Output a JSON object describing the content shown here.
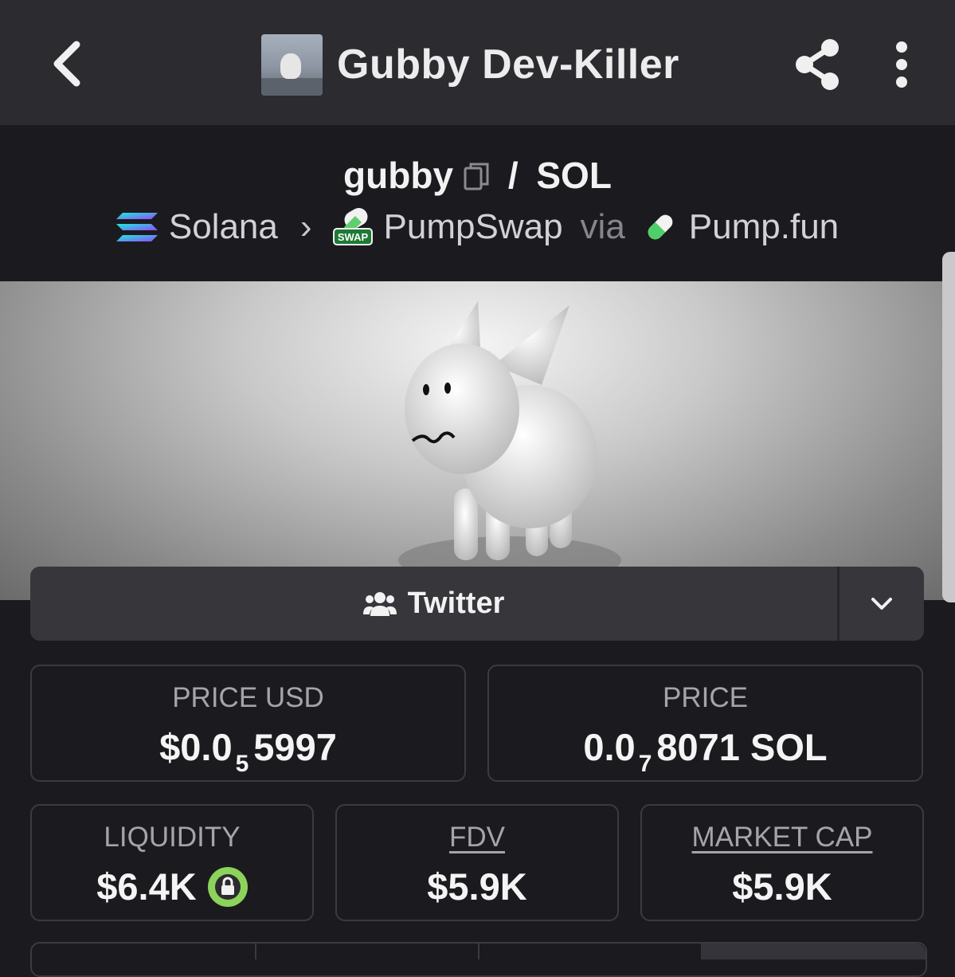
{
  "header": {
    "title": "Gubby Dev-Killer",
    "back_icon": "chevron-left-icon",
    "share_icon": "share-icon",
    "more_icon": "more-vertical-icon"
  },
  "pair": {
    "base": "gubby",
    "separator": "/",
    "quote": "SOL",
    "chain": "Solana",
    "dex": "PumpSwap",
    "via_label": "via",
    "launchpad": "Pump.fun",
    "dex_badge_text": "SWAP"
  },
  "twitter_bar": {
    "label": "Twitter",
    "icon": "users-icon",
    "dropdown_icon": "chevron-down-icon"
  },
  "stats": {
    "price_usd": {
      "label": "PRICE USD",
      "prefix": "$0.0",
      "zeros": "5",
      "digits": "5997"
    },
    "price": {
      "label": "PRICE",
      "prefix": "0.0",
      "zeros": "7",
      "digits": "8071",
      "unit": "SOL"
    },
    "liquidity": {
      "label": "LIQUIDITY",
      "value": "$6.4K",
      "lock_icon": "lock-icon"
    },
    "fdv": {
      "label": "FDV",
      "value": "$5.9K"
    },
    "market_cap": {
      "label": "MARKET CAP",
      "value": "$5.9K"
    }
  },
  "colors": {
    "background": "#1b1b1f",
    "header": "#2b2b30",
    "card_border": "#3a3a40",
    "lock_green": "#8bd35a"
  }
}
